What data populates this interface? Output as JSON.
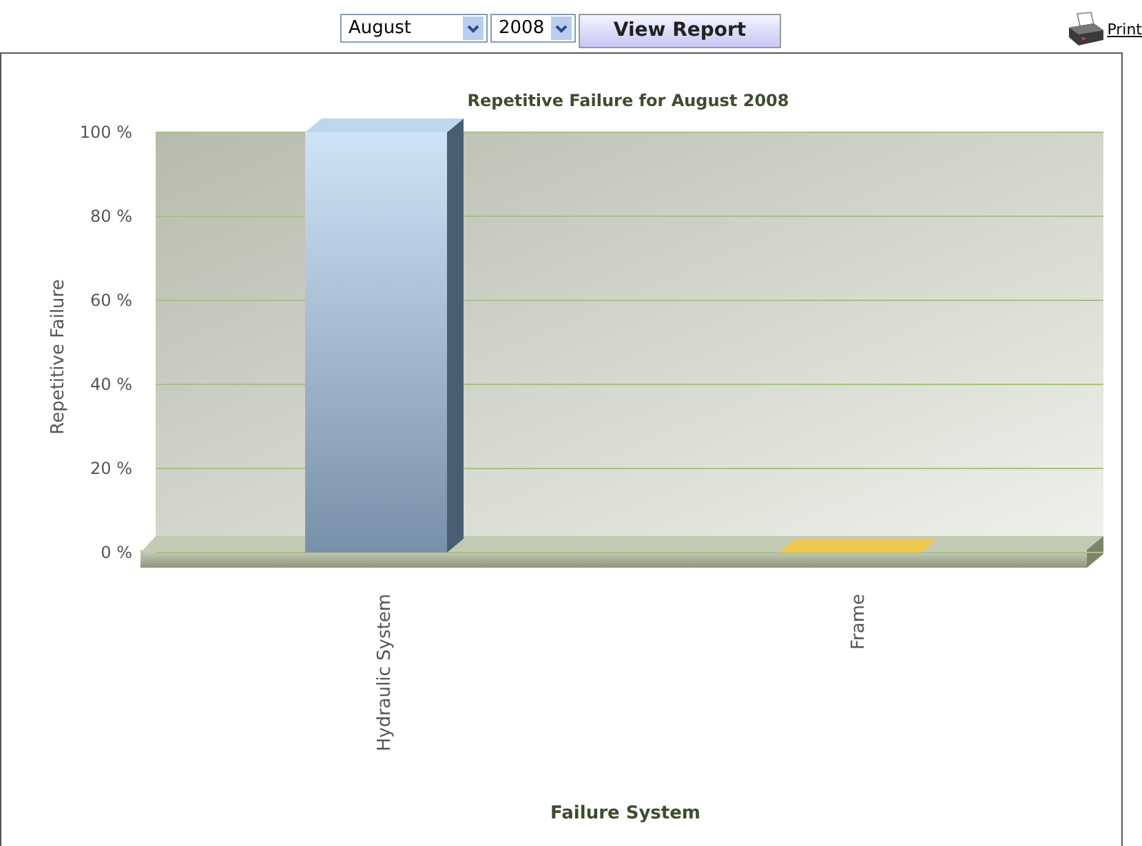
{
  "toolbar": {
    "month": "August",
    "year": "2008",
    "button": "View Report",
    "print": "Print"
  },
  "chart": {
    "chart_data": {
      "type": "bar",
      "title": "Repetitive Failure for August 2008",
      "xlabel": "Failure System",
      "ylabel": "Repetitive Failure",
      "categories": [
        "Hydraulic System",
        "Frame"
      ],
      "values": [
        100,
        0
      ],
      "ylim": [
        0,
        100
      ],
      "grid": true,
      "yticks": [
        {
          "value": 0,
          "label": "0 %"
        },
        {
          "value": 20,
          "label": "20 %"
        },
        {
          "value": 40,
          "label": "40 %"
        },
        {
          "value": 60,
          "label": "60 %"
        },
        {
          "value": 80,
          "label": "80 %"
        },
        {
          "value": 100,
          "label": "100 %"
        }
      ]
    }
  }
}
